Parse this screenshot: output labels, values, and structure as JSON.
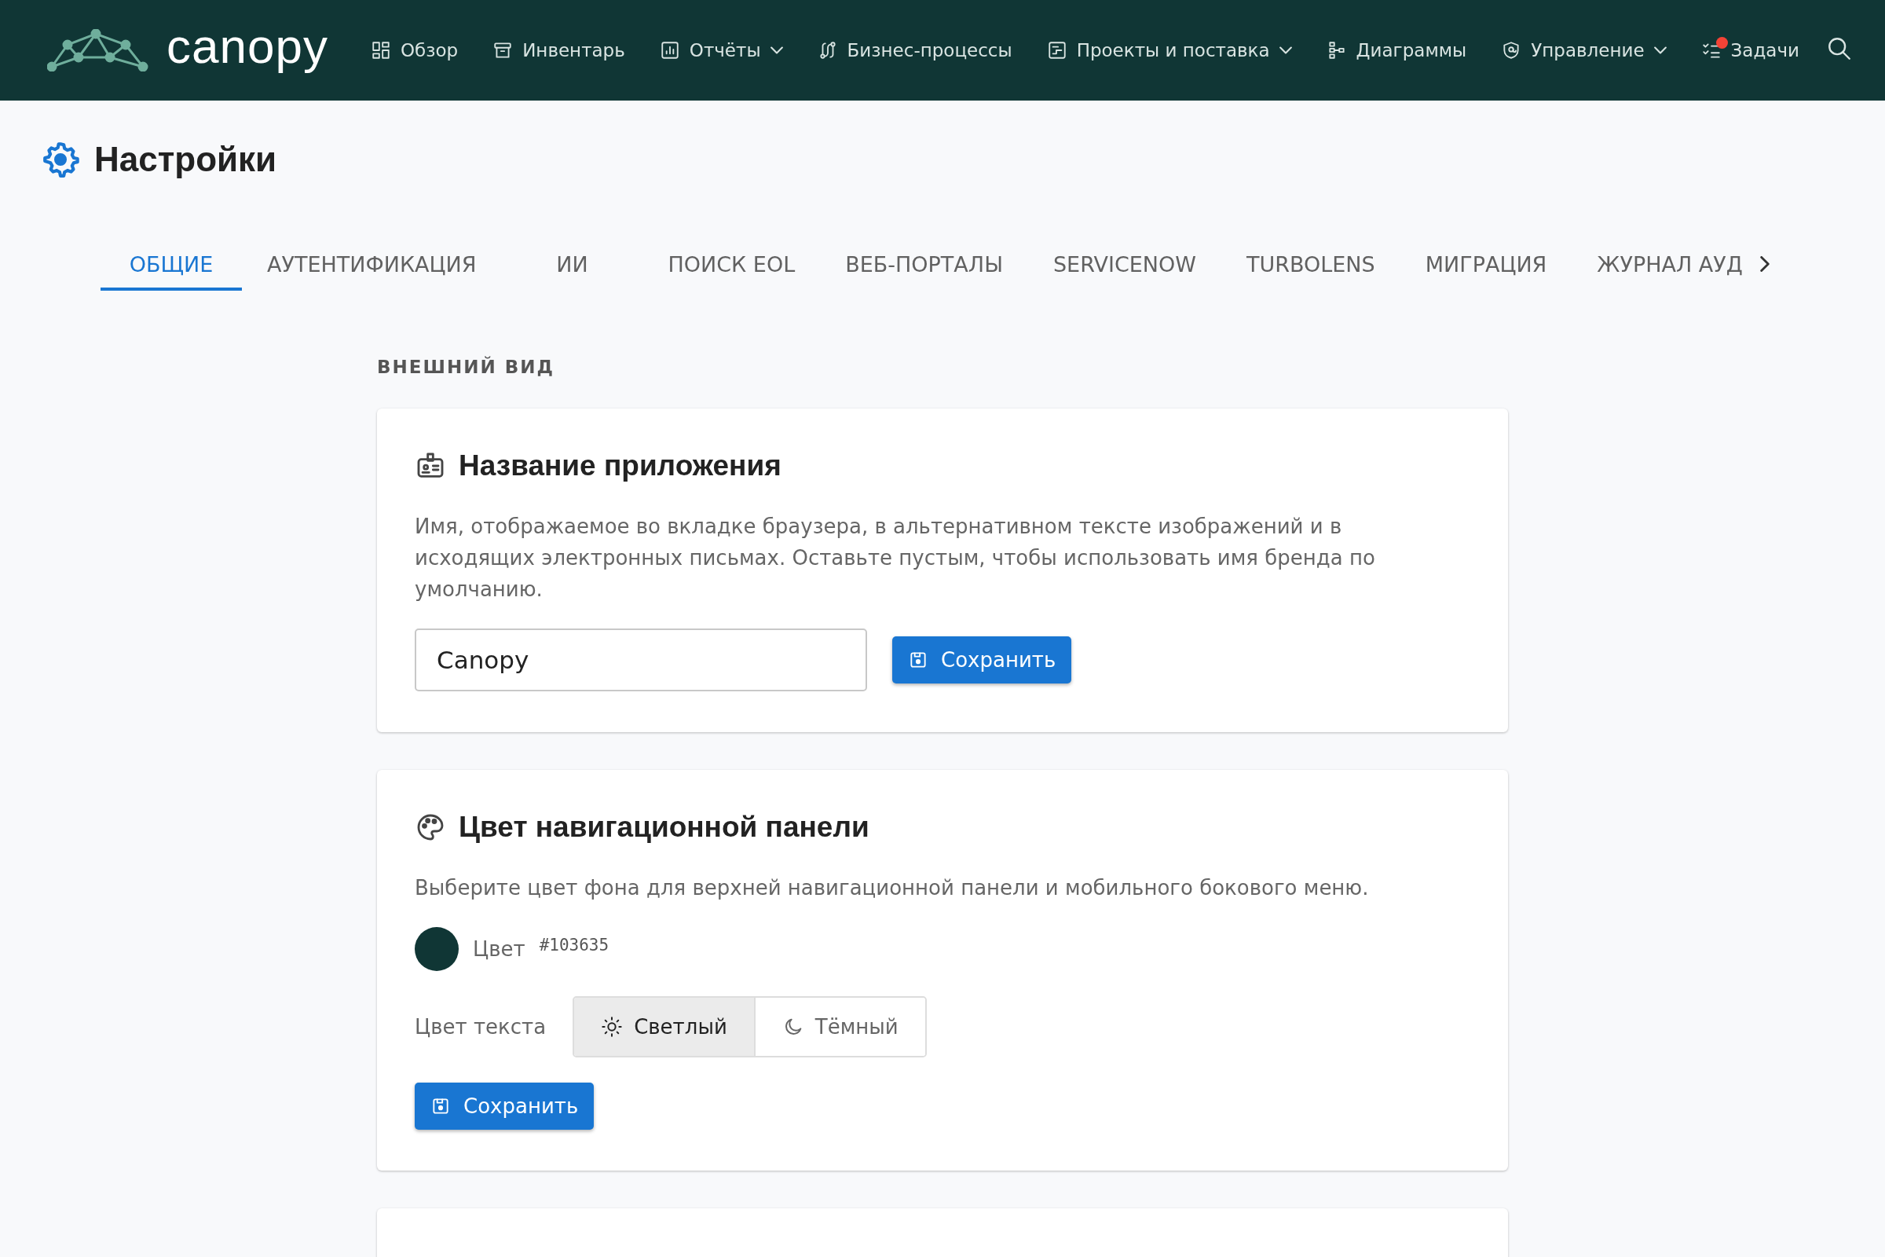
{
  "nav": {
    "logo": "canopy",
    "items": [
      {
        "label": "Обзор",
        "dropdown": false,
        "notification": false
      },
      {
        "label": "Инвентарь",
        "dropdown": false,
        "notification": false
      },
      {
        "label": "Отчёты",
        "dropdown": true,
        "notification": false
      },
      {
        "label": "Бизнес-процессы",
        "dropdown": false,
        "notification": false
      },
      {
        "label": "Проекты и поставка",
        "dropdown": true,
        "notification": false
      },
      {
        "label": "Диаграммы",
        "dropdown": false,
        "notification": false
      },
      {
        "label": "Управление",
        "dropdown": true,
        "notification": false
      },
      {
        "label": "Задачи",
        "dropdown": false,
        "notification": true
      }
    ]
  },
  "page_title": "Настройки",
  "tabs": [
    {
      "label": "ОБЩИЕ",
      "selected": true
    },
    {
      "label": "АУТЕНТИФИКАЦИЯ",
      "selected": false
    },
    {
      "label": "ИИ",
      "selected": false
    },
    {
      "label": "ПОИСК EOL",
      "selected": false
    },
    {
      "label": "ВЕБ-ПОРТАЛЫ",
      "selected": false
    },
    {
      "label": "SERVICENOW",
      "selected": false
    },
    {
      "label": "TURBOLENS",
      "selected": false
    },
    {
      "label": "МИГРАЦИЯ",
      "selected": false
    },
    {
      "label": "ЖУРНАЛ АУД",
      "selected": false
    }
  ],
  "section_label": "ВНЕШНИЙ ВИД",
  "app_name_card": {
    "title": "Название приложения",
    "description": "Имя, отображаемое во вкладке браузера, в альтернативном тексте изображений и в исходящих электронных письмах. Оставьте пустым, чтобы использовать имя бренда по умолчанию.",
    "value": "Canopy",
    "button": "Сохранить"
  },
  "nav_color_card": {
    "title": "Цвет навигационной панели",
    "description": "Выберите цвет фона для верхней навигационной панели и мобильного бокового меню.",
    "swatch": {
      "label": "Цвет",
      "value": "#103635",
      "color": "#103635"
    },
    "text_color": {
      "label": "Цвет текста",
      "options": [
        {
          "label": "Светлый",
          "selected": true
        },
        {
          "label": "Тёмный",
          "selected": false
        }
      ]
    },
    "button": "Сохранить"
  }
}
